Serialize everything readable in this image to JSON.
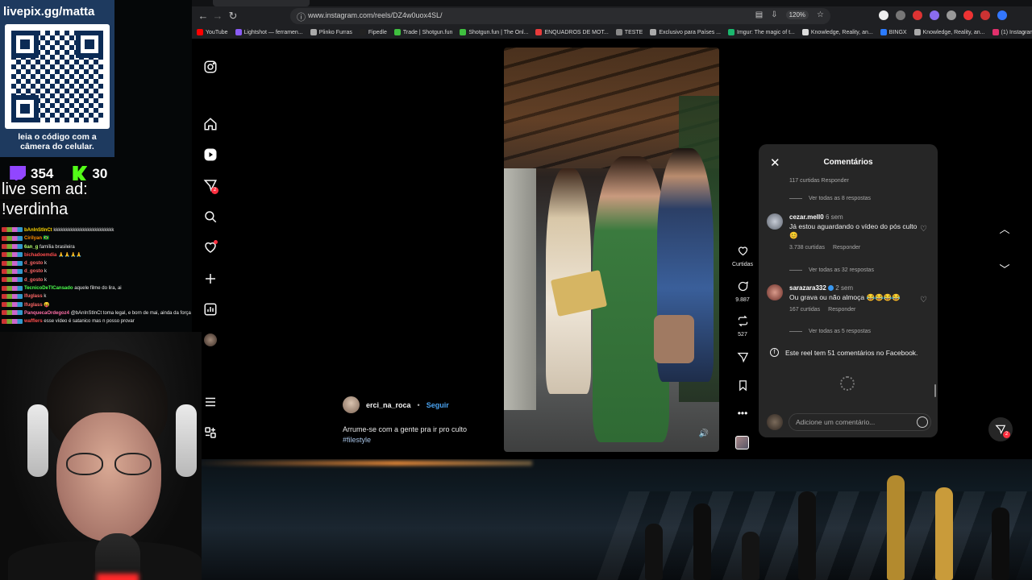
{
  "browser": {
    "url": "www.instagram.com/reels/DZ4w0uox4SL/",
    "zoom": "120%",
    "bookmarks": [
      {
        "label": "YouTube",
        "color": "#ff0000"
      },
      {
        "label": "Lightshot — ferramen...",
        "color": "#8a5cf6"
      },
      {
        "label": "Plinko Furras",
        "color": "#aaaaaa"
      },
      {
        "label": "Fipedle",
        "color": "#222222"
      },
      {
        "label": "Trade | Shotgun.fun",
        "color": "#3fbf3f"
      },
      {
        "label": "Shotgun.fun | The Onl...",
        "color": "#3fbf3f"
      },
      {
        "label": "ENQUADROS DE MOT...",
        "color": "#e83b3b"
      },
      {
        "label": "TESTE",
        "color": "#888888"
      },
      {
        "label": "Exclusivo para Países ...",
        "color": "#aaaaaa"
      },
      {
        "label": "Imgur: The magic of t...",
        "color": "#1bb76e"
      },
      {
        "label": "Knowledge, Reality, an...",
        "color": "#dddddd"
      },
      {
        "label": "BINGX",
        "color": "#2b7bff"
      },
      {
        "label": "Knowledge, Reality, an...",
        "color": "#aaaaaa"
      },
      {
        "label": "(1) Instagram",
        "color": "#e1306c"
      }
    ]
  },
  "sidebar": {
    "notifications_badge": "2"
  },
  "reel": {
    "username": "erci_na_roca",
    "follow": "Seguir",
    "separator": "•",
    "caption": "Arrume-se com a gente pra ir pro culto",
    "hashtag": "#filestyle",
    "likes_label": "Curtidas",
    "comments_count": "9.887",
    "reposts_count": "527"
  },
  "comments": {
    "title": "Comentários",
    "top_meta": "117 curtidas   Responder",
    "items": [
      {
        "user": "cezar.mell0",
        "ago": "6 sem",
        "text": "Já estou aguardando o vídeo do pós culto 😊",
        "likes": "3.738 curtidas",
        "reply": "Responder",
        "view_replies": "Ver todas as 32 respostas",
        "avatar_color": "#8a8f99"
      },
      {
        "user": "sarazara332",
        "ago": "2 sem",
        "text": "Ou grava ou não almoça 😂😂😂😂",
        "likes": "167 curtidas",
        "reply": "Responder",
        "view_replies": "Ver todas as 5 respostas",
        "avatar_color": "#a5524a"
      }
    ],
    "first_view_replies": "Ver todas as 8 respostas",
    "facebook_note": "Este reel tem 51 comentários no Facebook.",
    "input_placeholder": "Adicione um comentário..."
  },
  "dm_badge": "2",
  "overlay": {
    "qr_title": "livepix.gg/matta",
    "qr_caption_line1": "leia o código com a",
    "qr_caption_line2": "câmera do celular.",
    "twitch_viewers": "354",
    "kick_viewers": "30",
    "ad_line1": "live sem ad:",
    "ad_line2": "!verdinha",
    "chat": [
      {
        "user": "bAnInStInCt",
        "color": "#ffd700",
        "text": "kkkkkkkkkkkkkkkkkkkkkkkkk"
      },
      {
        "user": "Cirilyan",
        "color": "#ff8c00",
        "text": "🇧🇷"
      },
      {
        "user": "6an_g",
        "color": "#b6ff6b",
        "text": "família brasileira"
      },
      {
        "user": "bichadoemdia",
        "color": "#ff4d4d",
        "text": "🙏🙏🙏🙏"
      },
      {
        "user": "d_gosto",
        "color": "#ff6666",
        "text": "k"
      },
      {
        "user": "d_gosto",
        "color": "#ff6666",
        "text": "k"
      },
      {
        "user": "d_gosto",
        "color": "#ff6666",
        "text": "k"
      },
      {
        "user": "TecnicoDeTICansado",
        "color": "#4cff4c",
        "text": "aquele filme do lira, ai"
      },
      {
        "user": "lfuglass",
        "color": "#ff6666",
        "text": "k"
      },
      {
        "user": "lfuglass",
        "color": "#ff6666",
        "text": "😝"
      },
      {
        "user": "PanquecaOrdegoz4",
        "color": "#ff6fa8",
        "text": "@bAnInStInCt toma legal, e born de mai, ainda da força no 🙏"
      },
      {
        "user": "wafflers",
        "color": "#ff4d4d",
        "text": "esse vídeo é satanico mas n posso provar"
      }
    ]
  }
}
